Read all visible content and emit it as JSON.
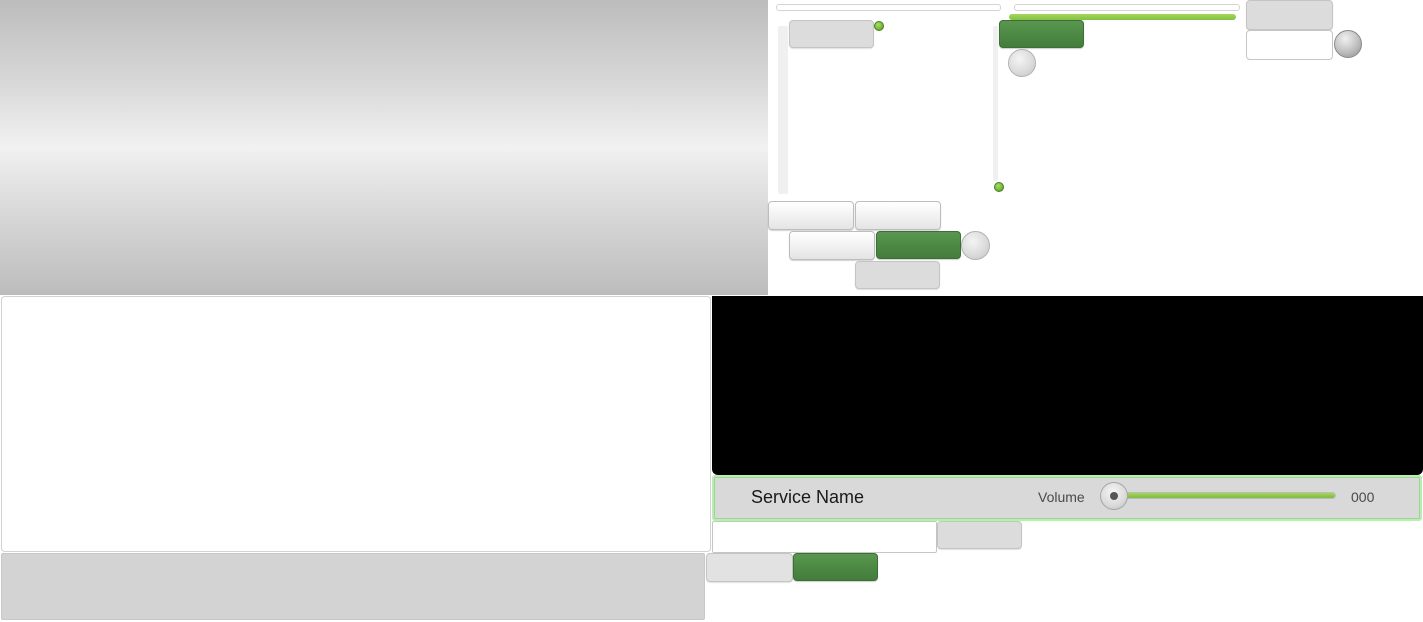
{
  "service_bar": {
    "service_name": "Service Name",
    "volume_label": "Volume",
    "volume_value": "000",
    "volume_level": 0.0
  },
  "colors": {
    "accent_green": "#4d8a44",
    "slider_green": "#8ac64a",
    "video_background": "#000000",
    "service_bar_border": "#b8efb0"
  }
}
